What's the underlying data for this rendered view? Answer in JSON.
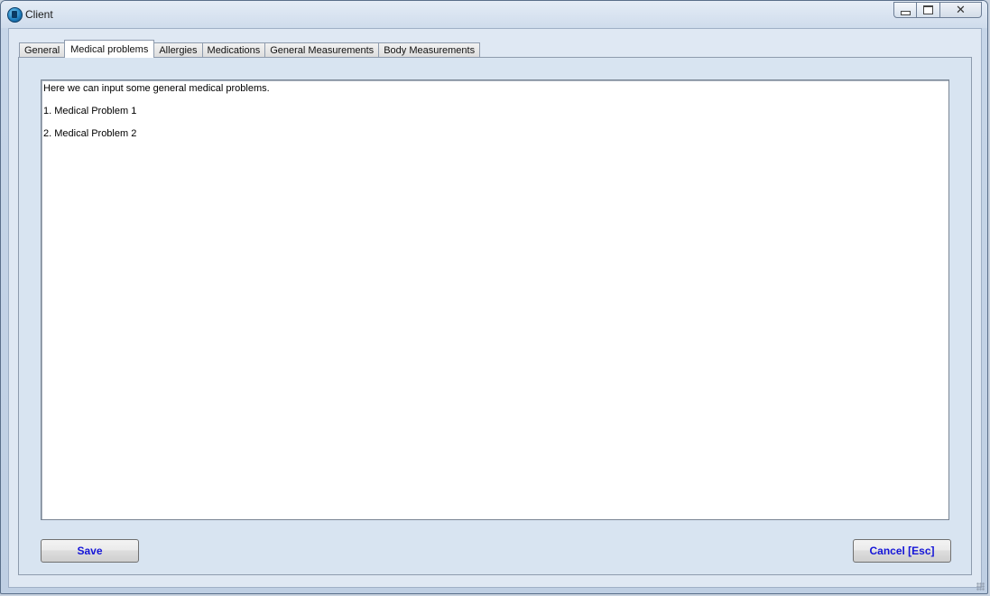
{
  "window": {
    "title": "Client"
  },
  "tabs": [
    {
      "label": "General",
      "active": false
    },
    {
      "label": "Medical problems",
      "active": true
    },
    {
      "label": "Allergies",
      "active": false
    },
    {
      "label": "Medications",
      "active": false
    },
    {
      "label": "General Measurements",
      "active": false
    },
    {
      "label": "Body Measurements",
      "active": false
    }
  ],
  "editor": {
    "lines": [
      "Here we can input some general medical problems.",
      "1. Medical Problem 1",
      "2. Medical Problem 2"
    ]
  },
  "buttons": {
    "save_label": "Save",
    "cancel_label": "Cancel [Esc]"
  },
  "colors": {
    "button_text": "#1515d8",
    "panel_bg": "#d8e4f1"
  },
  "icons": {
    "app": "app-icon",
    "minimize": "minimize-icon",
    "maximize": "maximize-icon",
    "close": "close-icon"
  }
}
